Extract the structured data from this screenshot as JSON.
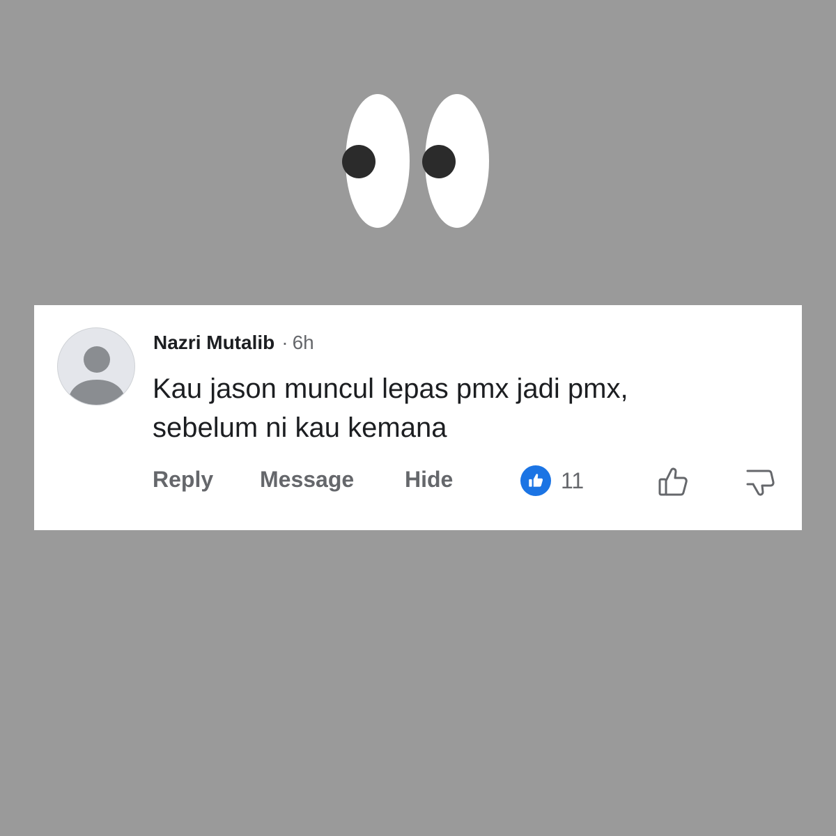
{
  "comment": {
    "author": "Nazri Mutalib",
    "separator": "·",
    "time": "6h",
    "text": "Kau jason muncul lepas pmx jadi pmx,\nsebelum ni kau kemana"
  },
  "actions": {
    "reply": "Reply",
    "message": "Message",
    "hide": "Hide"
  },
  "reactions": {
    "like_count": "11",
    "icon": "like-icon"
  },
  "colors": {
    "background": "#9a9a9a",
    "card": "#ffffff",
    "like_blue": "#1b74e4",
    "secondary_text": "#65676b",
    "primary_text": "#1c1e21"
  },
  "decoration": {
    "icon": "eyes-icon"
  }
}
